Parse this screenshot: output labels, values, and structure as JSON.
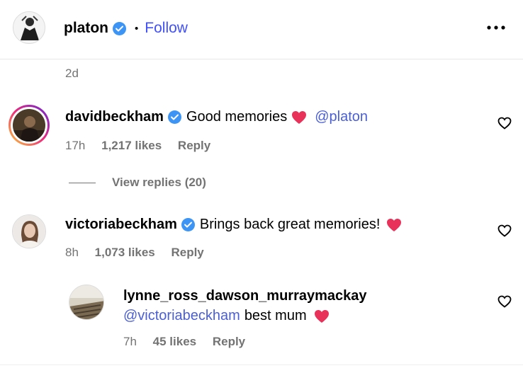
{
  "post": {
    "author": "platon",
    "dot": "•",
    "follow_label": "Follow",
    "more_label": "•••",
    "time": "2d"
  },
  "comments": [
    {
      "username": "davidbeckham",
      "text": "Good memories",
      "mention": "@platon",
      "time": "17h",
      "likes": "1,217 likes",
      "reply_label": "Reply",
      "view_replies": "View replies (20)"
    },
    {
      "username": "victoriabeckham",
      "text": "Brings back great memories!",
      "time": "8h",
      "likes": "1,073 likes",
      "reply_label": "Reply",
      "replies": [
        {
          "username": "lynne_ross_dawson_murraymackay",
          "mention": "@victoriabeckham",
          "text": "best mum",
          "time": "7h",
          "likes": "45 likes",
          "reply_label": "Reply"
        }
      ]
    }
  ],
  "colors": {
    "verified": "#3c95f4",
    "follow": "#4150f7",
    "mention": "#4a5fd6",
    "emoji_heart": "#e8325a",
    "muted": "#737373",
    "story_ring": [
      "#f9ce34",
      "#ee2a7b",
      "#6228d7"
    ]
  },
  "icons": [
    "verified-badge-icon",
    "more-icon",
    "heart-outline-icon",
    "red-heart-emoji"
  ]
}
